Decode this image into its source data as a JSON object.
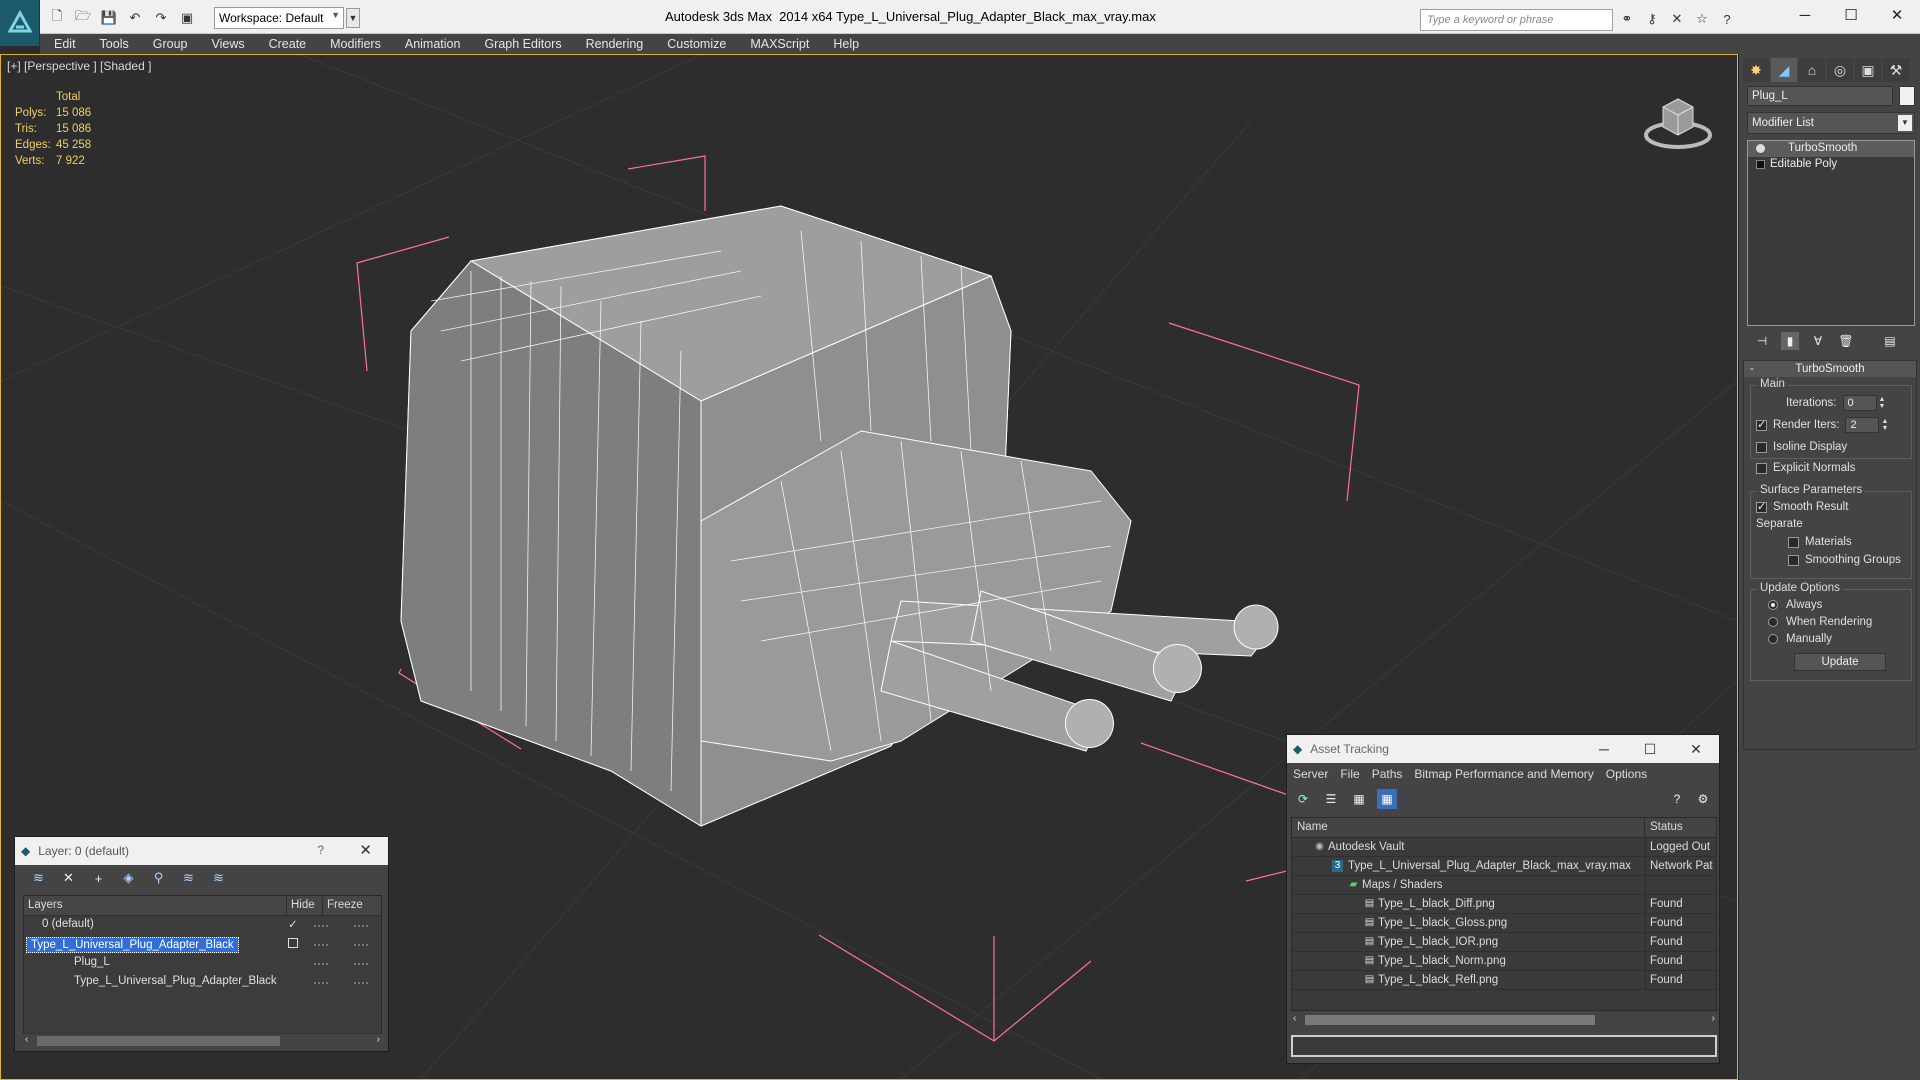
{
  "titlebar": {
    "workspace": "Workspace: Default",
    "app_title": "Autodesk 3ds Max  2014 x64",
    "file_title": "Type_L_Universal_Plug_Adapter_Black_max_vray.max",
    "search_placeholder": "Type a keyword or phrase"
  },
  "menu": [
    "Edit",
    "Tools",
    "Group",
    "Views",
    "Create",
    "Modifiers",
    "Animation",
    "Graph Editors",
    "Rendering",
    "Customize",
    "MAXScript",
    "Help"
  ],
  "viewport": {
    "label": "[+] [Perspective ] [Shaded ]",
    "stats": {
      "header": "Total",
      "polys_label": "Polys:",
      "polys": "15 086",
      "tris_label": "Tris:",
      "tris": "15 086",
      "edges_label": "Edges:",
      "edges": "45 258",
      "verts_label": "Verts:",
      "verts": "7 922"
    }
  },
  "layer_panel": {
    "title": "Layer: 0 (default)",
    "help": "?",
    "columns": {
      "layers": "Layers",
      "hide": "Hide",
      "freeze": "Freeze"
    },
    "rows": [
      {
        "name": "0 (default)"
      },
      {
        "name": "Type_L_Universal_Plug_Adapter_Black"
      },
      {
        "name": "Plug_L"
      },
      {
        "name": "Type_L_Universal_Plug_Adapter_Black"
      }
    ]
  },
  "asset_tracking": {
    "title": "Asset Tracking",
    "menu": [
      "Server",
      "File",
      "Paths",
      "Bitmap Performance and Memory",
      "Options"
    ],
    "columns": {
      "name": "Name",
      "status": "Status"
    },
    "rows": [
      {
        "name": "Autodesk Vault",
        "status": "Logged Out"
      },
      {
        "name": "Type_L_Universal_Plug_Adapter_Black_max_vray.max",
        "status": "Network Pat"
      },
      {
        "name": "Maps / Shaders",
        "status": ""
      },
      {
        "name": "Type_L_black_Diff.png",
        "status": "Found"
      },
      {
        "name": "Type_L_black_Gloss.png",
        "status": "Found"
      },
      {
        "name": "Type_L_black_IOR.png",
        "status": "Found"
      },
      {
        "name": "Type_L_black_Norm.png",
        "status": "Found"
      },
      {
        "name": "Type_L_black_Refl.png",
        "status": "Found"
      }
    ]
  },
  "command_panel": {
    "object_name": "Plug_L",
    "modifier_list": "Modifier List",
    "stack": [
      "TurboSmooth",
      "Editable Poly"
    ],
    "rollout": {
      "title": "TurboSmooth",
      "collapse": "-",
      "main_label": "Main",
      "iterations_label": "Iterations:",
      "iterations": "0",
      "render_iters_label": "Render Iters:",
      "render_iters": "2",
      "isoline": "Isoline Display",
      "explicit_normals": "Explicit Normals",
      "surface_label": "Surface Parameters",
      "smooth_result": "Smooth Result",
      "separate_label": "Separate",
      "materials": "Materials",
      "smoothing_groups": "Smoothing Groups",
      "update_label": "Update Options",
      "always": "Always",
      "when_rendering": "When Rendering",
      "manually": "Manually",
      "update_btn": "Update"
    }
  },
  "colors": {
    "accent": "#2f6fd5",
    "stats": "#f0d060",
    "wire": "#ffffff",
    "bbox": "#ff6f9f"
  }
}
